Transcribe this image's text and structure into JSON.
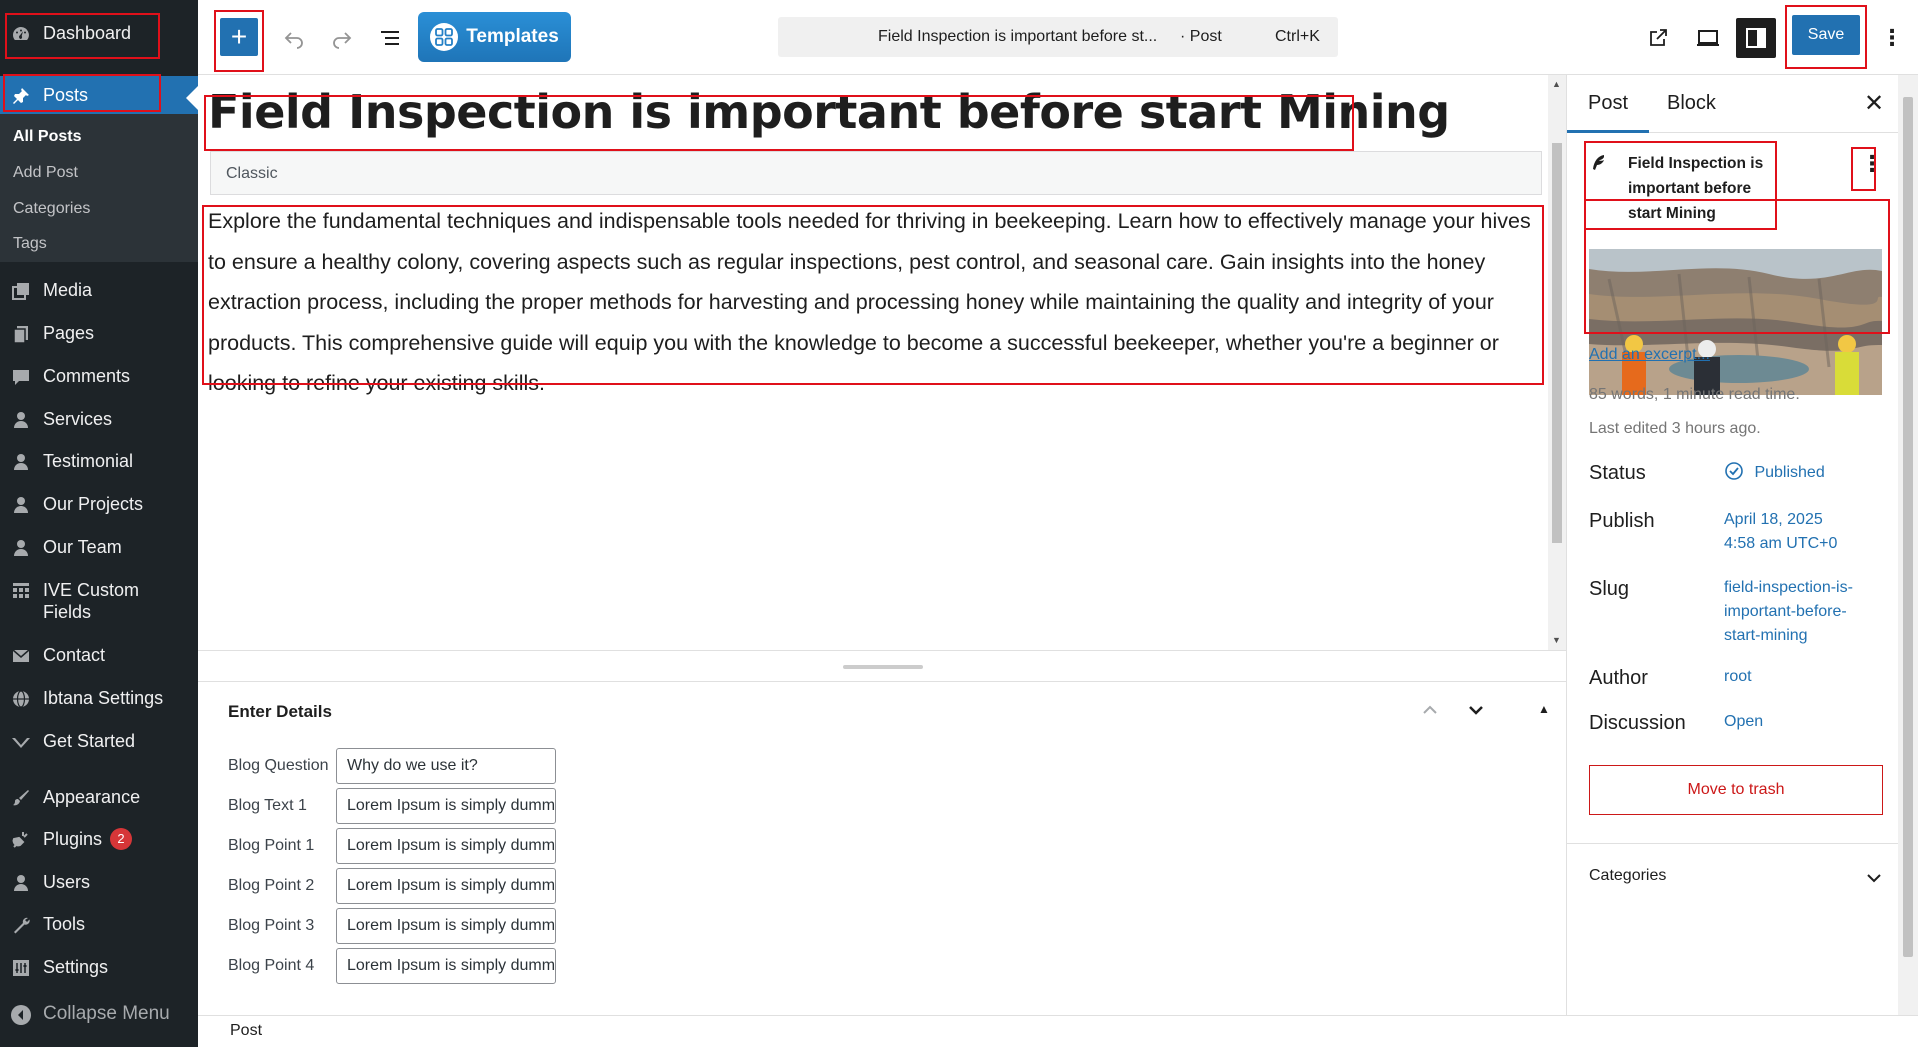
{
  "admin_menu": {
    "dashboard": "Dashboard",
    "posts": "Posts",
    "posts_submenu": [
      "All Posts",
      "Add Post",
      "Categories",
      "Tags"
    ],
    "media": "Media",
    "pages": "Pages",
    "comments": "Comments",
    "services": "Services",
    "testimonial": "Testimonial",
    "our_projects": "Our Projects",
    "our_team": "Our Team",
    "ive_custom_fields": "IVE Custom Fields",
    "contact": "Contact",
    "ibtana_settings": "Ibtana Settings",
    "get_started": "Get Started",
    "appearance": "Appearance",
    "plugins": "Plugins",
    "plugins_badge": "2",
    "users": "Users",
    "tools": "Tools",
    "settings": "Settings",
    "collapse_menu": "Collapse Menu"
  },
  "toolbar": {
    "templates_label": "Templates",
    "command_title": "Field Inspection is important before st...",
    "command_type": "· Post",
    "command_shortcut": "Ctrl+K",
    "save_label": "Save"
  },
  "editor": {
    "post_title": "Field Inspection is important before start Mining",
    "classic_label": "Classic",
    "body": "Explore the fundamental techniques and indispensable tools needed for thriving in beekeeping. Learn how to effectively manage your hives to ensure a healthy colony, covering aspects such as regular inspections, pest control, and seasonal care. Gain insights into the honey extraction process, including the proper methods for harvesting and processing honey while maintaining the quality and integrity of your products. This comprehensive guide will equip you with the knowledge to become a successful beekeeper, whether you're a beginner or looking to refine your existing skills."
  },
  "metabox": {
    "title": "Enter Details",
    "fields": [
      {
        "label": "Blog Question",
        "value": "Why do we use it?"
      },
      {
        "label": "Blog Text 1",
        "value": "Lorem Ipsum is simply dummy text"
      },
      {
        "label": "Blog Point 1",
        "value": "Lorem Ipsum is simply dummy text"
      },
      {
        "label": "Blog Point 2",
        "value": "Lorem Ipsum is simply dummy text"
      },
      {
        "label": "Blog Point 3",
        "value": "Lorem Ipsum is simply dummy text"
      },
      {
        "label": "Blog Point 4",
        "value": "Lorem Ipsum is simply dummy text"
      }
    ]
  },
  "footer": {
    "breadcrumb": "Post"
  },
  "sidebar": {
    "tab_post": "Post",
    "tab_block": "Block",
    "post_card_title": "Field Inspection is important before start Mining",
    "add_excerpt": "Add an excerpt...",
    "word_count": "85 words, 1 minute read time.",
    "last_edited": "Last edited 3 hours ago.",
    "status_label": "Status",
    "status_value": "Published",
    "publish_label": "Publish",
    "publish_value_line1": "April 18, 2025",
    "publish_value_line2": "4:58 am UTC+0",
    "slug_label": "Slug",
    "slug_line1": "field-inspection-is-",
    "slug_line2": "important-before-",
    "slug_line3": "start-mining",
    "author_label": "Author",
    "author_value": "root",
    "discussion_label": "Discussion",
    "discussion_value": "Open",
    "trash_label": "Move to trash",
    "categories_label": "Categories"
  },
  "colors": {
    "accent": "#2271b1",
    "admin_bg": "#1d2327",
    "highlight": "#e0101a"
  }
}
